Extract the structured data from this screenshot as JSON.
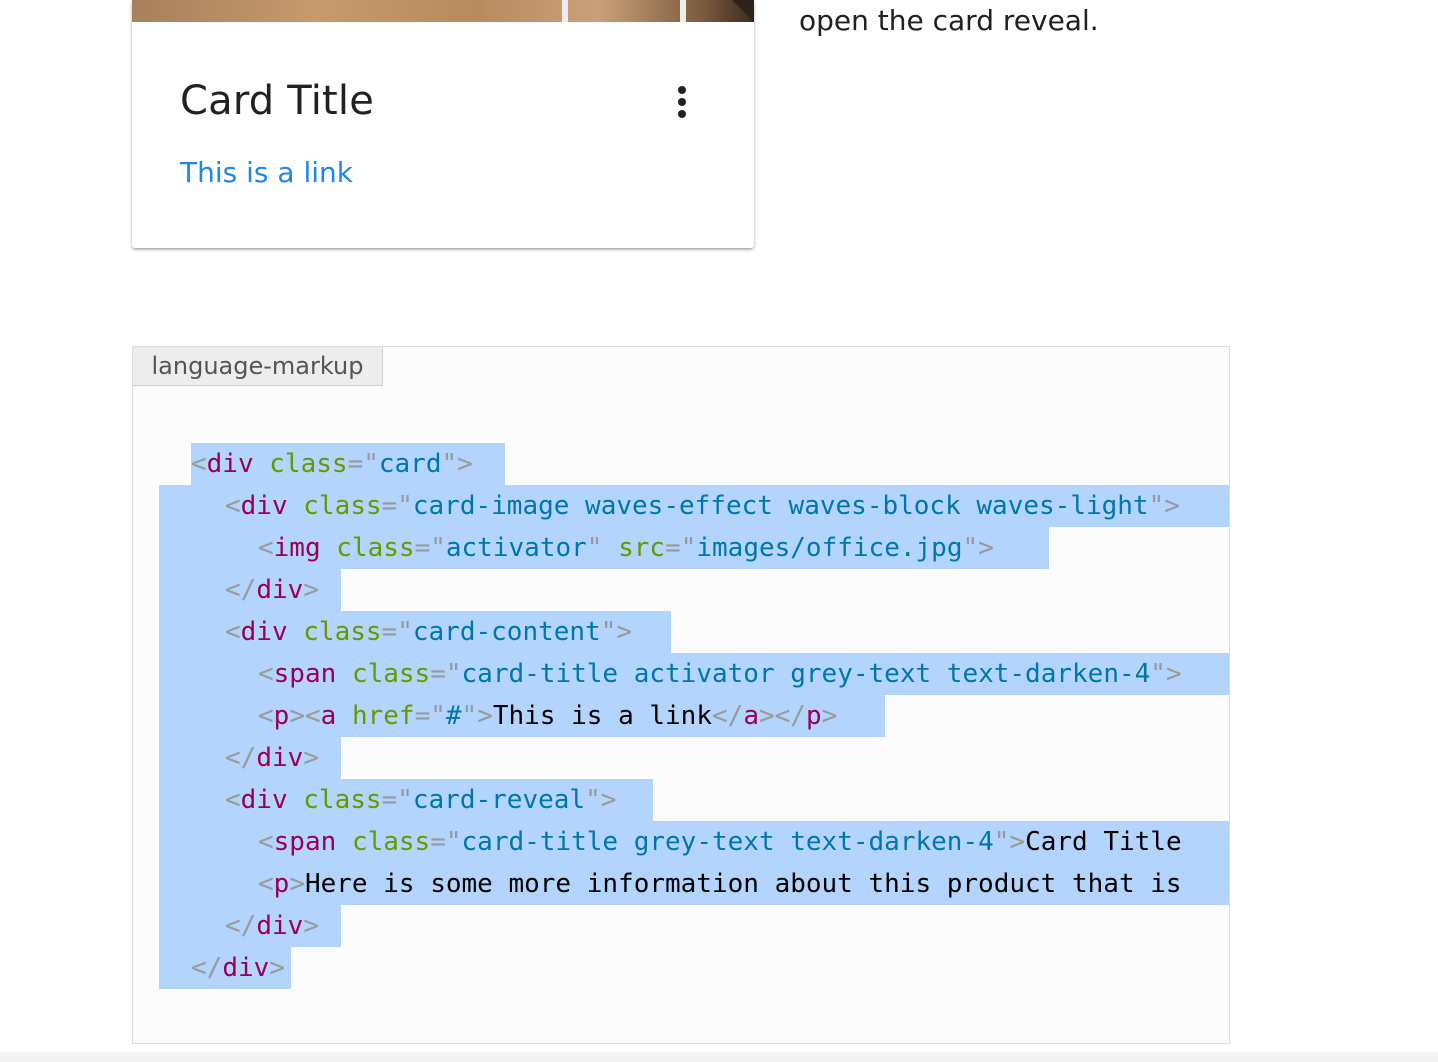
{
  "card": {
    "title": "Card Title",
    "link_text": "This is a link",
    "menu_icon": "more-vert-icon"
  },
  "side_text": "open the card reveal.",
  "code_block": {
    "language_label": "language-markup",
    "lines": [
      {
        "tokens": [
          [
            "p",
            "<"
          ],
          [
            "t",
            "div"
          ],
          [
            "x",
            " "
          ],
          [
            "a",
            "class"
          ],
          [
            "p",
            "="
          ],
          [
            "p",
            "\""
          ],
          [
            "v",
            "card"
          ],
          [
            "p",
            "\""
          ],
          [
            "p",
            ">"
          ]
        ]
      },
      {
        "tokens": [
          [
            "p",
            "<"
          ],
          [
            "t",
            "div"
          ],
          [
            "x",
            " "
          ],
          [
            "a",
            "class"
          ],
          [
            "p",
            "="
          ],
          [
            "p",
            "\""
          ],
          [
            "v",
            "card-image waves-effect waves-block waves-light"
          ],
          [
            "p",
            "\""
          ],
          [
            "p",
            ">"
          ]
        ]
      },
      {
        "tokens": [
          [
            "p",
            "<"
          ],
          [
            "t",
            "img"
          ],
          [
            "x",
            " "
          ],
          [
            "a",
            "class"
          ],
          [
            "p",
            "="
          ],
          [
            "p",
            "\""
          ],
          [
            "v",
            "activator"
          ],
          [
            "p",
            "\""
          ],
          [
            "x",
            " "
          ],
          [
            "a",
            "src"
          ],
          [
            "p",
            "="
          ],
          [
            "p",
            "\""
          ],
          [
            "v",
            "images/office.jpg"
          ],
          [
            "p",
            "\""
          ],
          [
            "p",
            ">"
          ]
        ]
      },
      {
        "tokens": [
          [
            "p",
            "</"
          ],
          [
            "t",
            "div"
          ],
          [
            "p",
            ">"
          ]
        ]
      },
      {
        "tokens": [
          [
            "p",
            "<"
          ],
          [
            "t",
            "div"
          ],
          [
            "x",
            " "
          ],
          [
            "a",
            "class"
          ],
          [
            "p",
            "="
          ],
          [
            "p",
            "\""
          ],
          [
            "v",
            "card-content"
          ],
          [
            "p",
            "\""
          ],
          [
            "p",
            ">"
          ]
        ]
      },
      {
        "tokens": [
          [
            "p",
            "<"
          ],
          [
            "t",
            "span"
          ],
          [
            "x",
            " "
          ],
          [
            "a",
            "class"
          ],
          [
            "p",
            "="
          ],
          [
            "p",
            "\""
          ],
          [
            "v",
            "card-title activator grey-text text-darken-4"
          ],
          [
            "p",
            "\""
          ],
          [
            "p",
            ">"
          ]
        ]
      },
      {
        "tokens": [
          [
            "p",
            "<"
          ],
          [
            "t",
            "p"
          ],
          [
            "p",
            ">"
          ],
          [
            "p",
            "<"
          ],
          [
            "t",
            "a"
          ],
          [
            "x",
            " "
          ],
          [
            "a",
            "href"
          ],
          [
            "p",
            "="
          ],
          [
            "p",
            "\""
          ],
          [
            "v",
            "#"
          ],
          [
            "p",
            "\""
          ],
          [
            "p",
            ">"
          ],
          [
            "x",
            "This is a link"
          ],
          [
            "p",
            "</"
          ],
          [
            "t",
            "a"
          ],
          [
            "p",
            ">"
          ],
          [
            "p",
            "</"
          ],
          [
            "t",
            "p"
          ],
          [
            "p",
            ">"
          ]
        ]
      },
      {
        "tokens": [
          [
            "p",
            "</"
          ],
          [
            "t",
            "div"
          ],
          [
            "p",
            ">"
          ]
        ]
      },
      {
        "tokens": [
          [
            "p",
            "<"
          ],
          [
            "t",
            "div"
          ],
          [
            "x",
            " "
          ],
          [
            "a",
            "class"
          ],
          [
            "p",
            "="
          ],
          [
            "p",
            "\""
          ],
          [
            "v",
            "card-reveal"
          ],
          [
            "p",
            "\""
          ],
          [
            "p",
            ">"
          ]
        ]
      },
      {
        "tokens": [
          [
            "p",
            "<"
          ],
          [
            "t",
            "span"
          ],
          [
            "x",
            " "
          ],
          [
            "a",
            "class"
          ],
          [
            "p",
            "="
          ],
          [
            "p",
            "\""
          ],
          [
            "v",
            "card-title grey-text text-darken-4"
          ],
          [
            "p",
            "\""
          ],
          [
            "p",
            ">"
          ],
          [
            "x",
            "Card Title"
          ]
        ]
      },
      {
        "tokens": [
          [
            "p",
            "<"
          ],
          [
            "t",
            "p"
          ],
          [
            "p",
            ">"
          ],
          [
            "x",
            "Here is some more information about this product that is"
          ]
        ]
      },
      {
        "tokens": [
          [
            "p",
            "</"
          ],
          [
            "t",
            "div"
          ],
          [
            "p",
            ">"
          ]
        ]
      },
      {
        "tokens": [
          [
            "p",
            "</"
          ],
          [
            "t",
            "div"
          ],
          [
            "p",
            ">"
          ]
        ]
      }
    ]
  }
}
